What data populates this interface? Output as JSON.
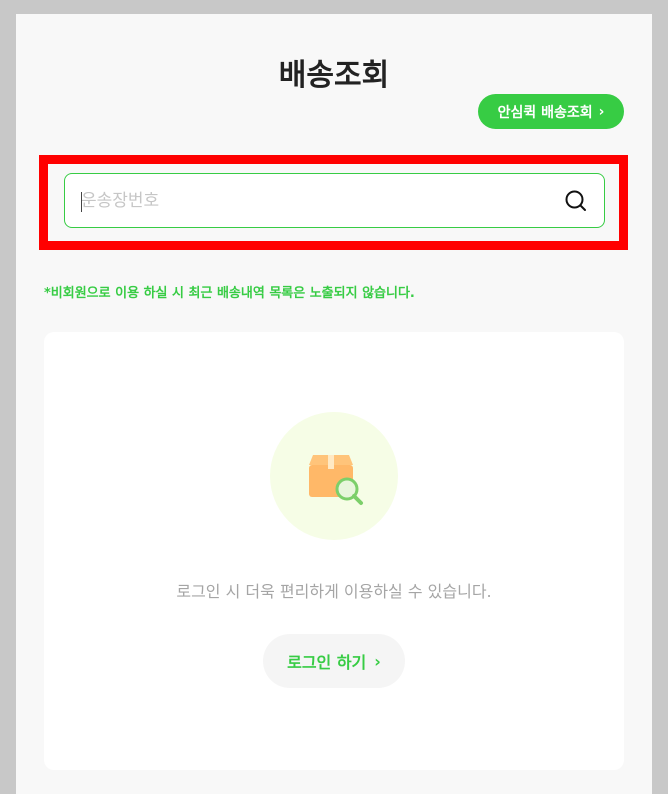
{
  "header": {
    "title": "배송조회",
    "safe_quick_button": "안심퀵 배송조회",
    "chevron": "›"
  },
  "search": {
    "placeholder": "운송장번호",
    "value": "",
    "icon": "search-icon"
  },
  "notice": "*비회원으로 이용 하실 시 최근 배송내역 목록은 노출되지 않습니다.",
  "card": {
    "message": "로그인 시 더욱 편리하게 이용하실 수 있습니다.",
    "login_button": "로그인 하기",
    "chevron": "›",
    "illustration": "package-search-icon"
  },
  "colors": {
    "accent": "#37cc44",
    "highlight": "#ff0000"
  }
}
